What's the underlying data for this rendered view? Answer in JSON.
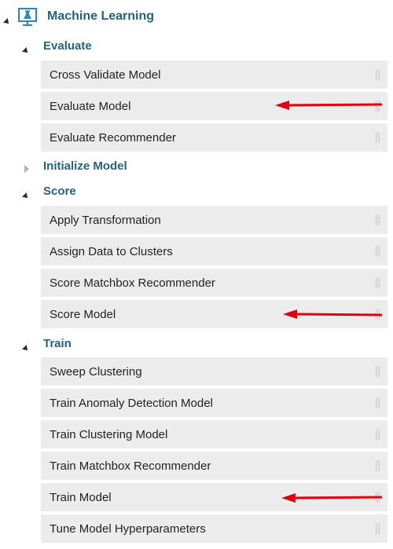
{
  "tree": {
    "root": {
      "label": "Machine Learning",
      "icon": "flask-monitor-icon",
      "expanded": true
    },
    "categories": [
      {
        "label": "Evaluate",
        "expanded": true,
        "items": [
          "Cross Validate Model",
          "Evaluate Model",
          "Evaluate Recommender"
        ]
      },
      {
        "label": "Initialize Model",
        "expanded": false,
        "items": []
      },
      {
        "label": "Score",
        "expanded": true,
        "items": [
          "Apply Transformation",
          "Assign Data to Clusters",
          "Score Matchbox Recommender",
          "Score Model"
        ]
      },
      {
        "label": "Train",
        "expanded": true,
        "items": [
          "Sweep Clustering",
          "Train Anomaly Detection Model",
          "Train Clustering Model",
          "Train Matchbox Recommender",
          "Train Model",
          "Tune Model Hyperparameters"
        ]
      }
    ]
  },
  "annotations": {
    "arrow_color": "#e3000f",
    "arrows_point_to": [
      "Evaluate Model",
      "Score Model",
      "Train Model"
    ]
  }
}
